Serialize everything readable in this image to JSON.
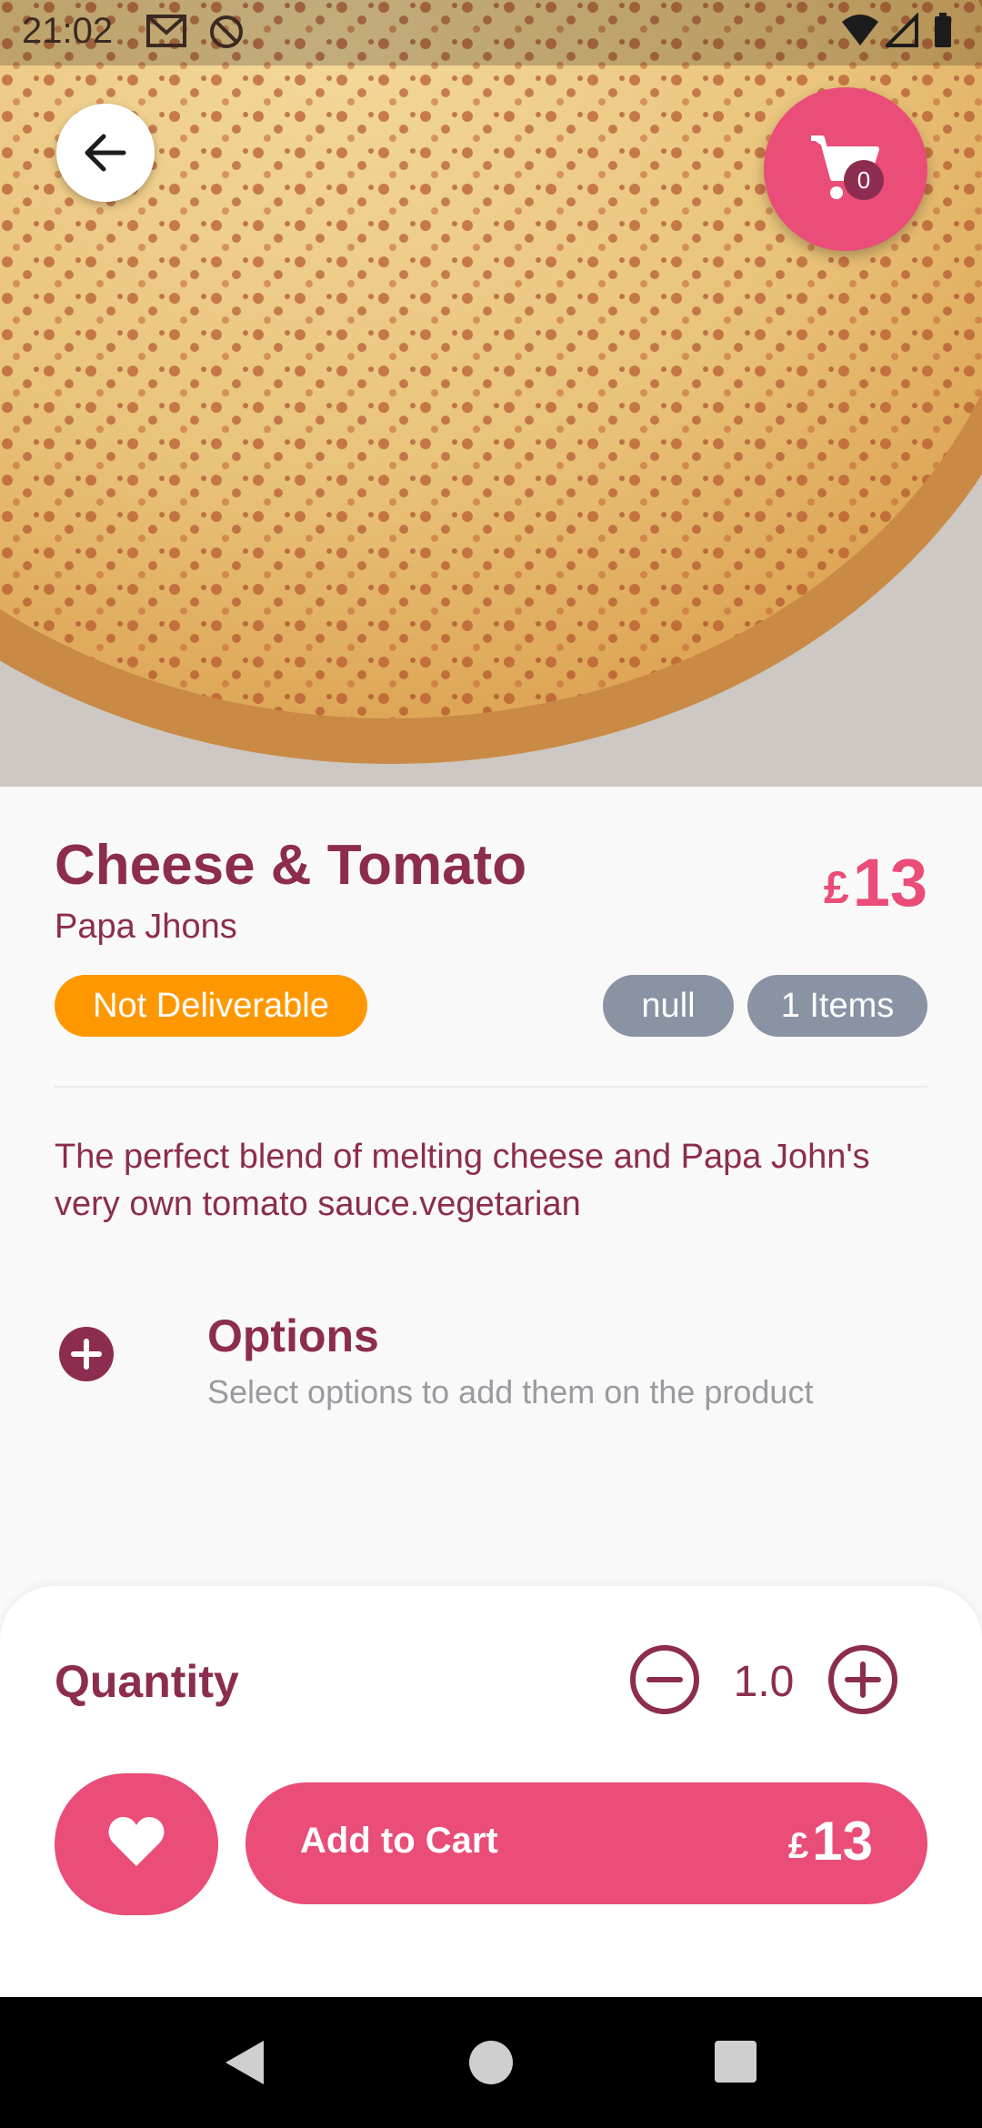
{
  "status_bar": {
    "time": "21:02"
  },
  "cart": {
    "count": "0"
  },
  "product": {
    "title": "Cheese & Tomato",
    "restaurant": "Papa Jhons",
    "price_currency": "£",
    "price_amount": "13",
    "deliverable_badge": "Not Deliverable",
    "tag_badge": "null",
    "items_badge": "1 Items",
    "description": "The perfect blend of melting cheese and Papa John's very own tomato sauce.vegetarian"
  },
  "options": {
    "title": "Options",
    "subtitle": "Select options to add them on the product"
  },
  "quantity": {
    "label": "Quantity",
    "value": "1.0"
  },
  "add_to_cart": {
    "label": "Add to Cart",
    "currency": "£",
    "amount": "13"
  },
  "colors": {
    "accent": "#e94d78",
    "primary_text": "#8c2d50",
    "badge_orange": "#ff9800",
    "badge_gray": "#8a93a3"
  },
  "icons": {
    "back": "arrow-left-icon",
    "cart": "shopping-cart-icon",
    "options": "plus-circle-icon",
    "minus": "minus-circle-icon",
    "plus": "plus-circle-outline-icon",
    "favorite": "heart-icon"
  }
}
